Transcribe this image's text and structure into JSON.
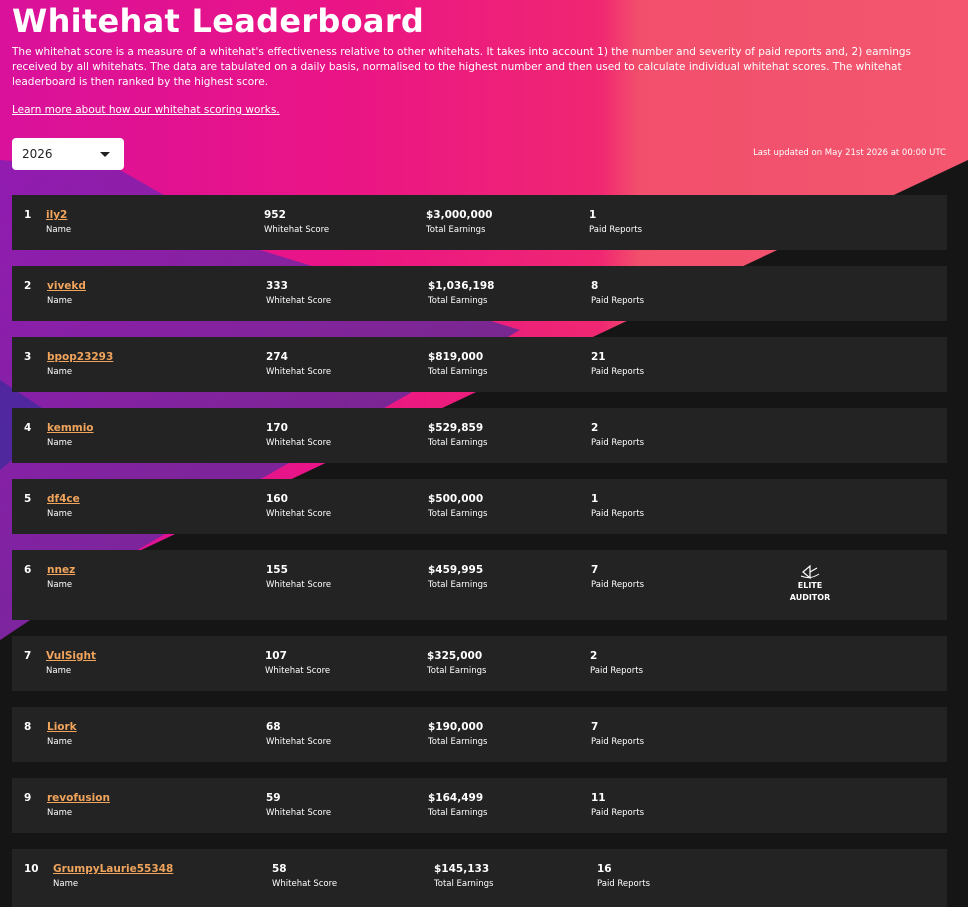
{
  "header": {
    "title": "Whitehat Leaderboard",
    "description": "The whitehat score is a measure of a whitehat's effectiveness relative to other whitehats. It takes into account 1) the number and severity of paid reports and, 2) earnings received by all whitehats. The data are tabulated on a daily basis, normalised to the highest number and then used to calculate individual whitehat scores. The whitehat leaderboard is then ranked by the highest score.",
    "learn_more": "Learn more about how our whitehat scoring works.",
    "year_selected": "2026",
    "last_updated": "Last updated on May 21st 2026 at 00:00 UTC"
  },
  "labels": {
    "name": "Name",
    "score": "Whitehat Score",
    "earnings": "Total Earnings",
    "reports": "Paid Reports"
  },
  "rows": [
    {
      "rank": "1",
      "name": "ily2",
      "score": "952",
      "earnings": "$3,000,000",
      "reports": "1"
    },
    {
      "rank": "2",
      "name": "vivekd",
      "score": "333",
      "earnings": "$1,036,198",
      "reports": "8"
    },
    {
      "rank": "3",
      "name": "bpop23293",
      "score": "274",
      "earnings": "$819,000",
      "reports": "21"
    },
    {
      "rank": "4",
      "name": "kemmio",
      "score": "170",
      "earnings": "$529,859",
      "reports": "2"
    },
    {
      "rank": "5",
      "name": "df4ce",
      "score": "160",
      "earnings": "$500,000",
      "reports": "1"
    },
    {
      "rank": "6",
      "name": "nnez",
      "score": "155",
      "earnings": "$459,995",
      "reports": "7",
      "badge": {
        "line1": "ELITE",
        "line2": "AUDITOR",
        "icon": "elite-auditor-icon"
      }
    },
    {
      "rank": "7",
      "name": "VulSight",
      "score": "107",
      "earnings": "$325,000",
      "reports": "2"
    },
    {
      "rank": "8",
      "name": "Liork",
      "score": "68",
      "earnings": "$190,000",
      "reports": "7"
    },
    {
      "rank": "9",
      "name": "revofusion",
      "score": "59",
      "earnings": "$164,499",
      "reports": "11"
    },
    {
      "rank": "10",
      "name": "GrumpyLaurie55348",
      "score": "58",
      "earnings": "$145,133",
      "reports": "16"
    }
  ],
  "colors": {
    "background": "#151515",
    "row": "#232323",
    "link": "#f0a45c",
    "magenta": "#e3158c",
    "coral": "#f2456a",
    "purple": "#6a24a8"
  }
}
